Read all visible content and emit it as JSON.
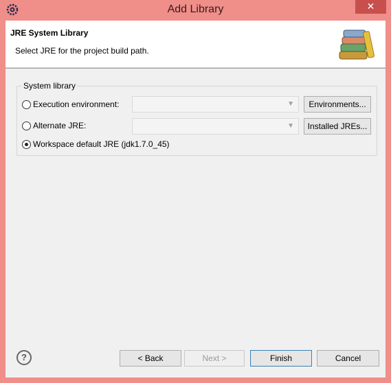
{
  "window": {
    "title": "Add Library",
    "close_label": "✕"
  },
  "banner": {
    "title": "JRE System Library",
    "description": "Select JRE for the project build path."
  },
  "group": {
    "title": "System library",
    "options": [
      {
        "label": "Execution environment:",
        "checked": false
      },
      {
        "label": "Alternate JRE:",
        "checked": false
      },
      {
        "label": "Workspace default JRE (jdk1.7.0_45)",
        "checked": true
      }
    ],
    "environments_button": "Environments...",
    "installed_jres_button": "Installed JREs..."
  },
  "footer": {
    "help_label": "?",
    "back_label": "< Back",
    "next_label": "Next >",
    "finish_label": "Finish",
    "cancel_label": "Cancel"
  },
  "icons": {
    "app": "gear-icon",
    "banner": "books-icon",
    "help": "help-icon"
  }
}
